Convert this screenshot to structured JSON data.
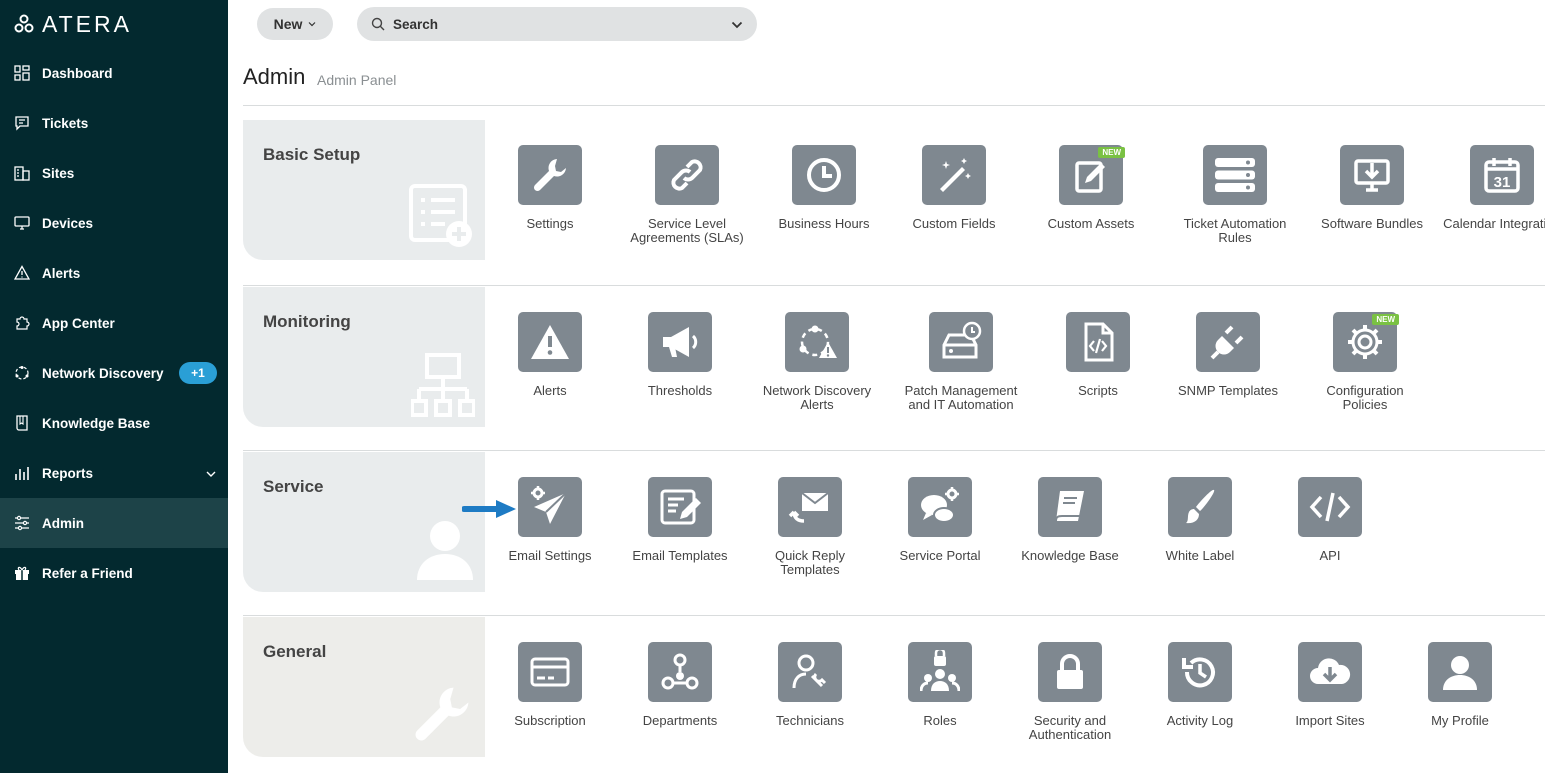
{
  "app": {
    "logo_text": "ATERA"
  },
  "sidebar": {
    "items": [
      {
        "label": "Dashboard",
        "icon": "dashboard-icon"
      },
      {
        "label": "Tickets",
        "icon": "tickets-icon"
      },
      {
        "label": "Sites",
        "icon": "sites-icon"
      },
      {
        "label": "Devices",
        "icon": "devices-icon"
      },
      {
        "label": "Alerts",
        "icon": "alerts-icon"
      },
      {
        "label": "App Center",
        "icon": "app-center-icon"
      },
      {
        "label": "Network Discovery",
        "icon": "network-discovery-icon",
        "badge": "+1"
      },
      {
        "label": "Knowledge Base",
        "icon": "knowledge-base-icon"
      },
      {
        "label": "Reports",
        "icon": "reports-icon"
      },
      {
        "label": "Admin",
        "icon": "admin-icon",
        "active": true
      },
      {
        "label": "Refer a Friend",
        "icon": "gift-icon"
      }
    ]
  },
  "toolbar": {
    "new_label": "New",
    "search_label": "Search"
  },
  "page": {
    "title": "Admin",
    "subtitle": "Admin Panel"
  },
  "sections": [
    {
      "title": "Basic Setup",
      "tiles": [
        {
          "label": "Settings",
          "icon": "wrench-icon"
        },
        {
          "label": "Service Level Agreements (SLAs)",
          "icon": "link-icon"
        },
        {
          "label": "Business Hours",
          "icon": "clock-icon"
        },
        {
          "label": "Custom Fields",
          "icon": "magic-wand-icon"
        },
        {
          "label": "Custom Assets",
          "icon": "edit-clipboard-icon",
          "new": "NEW"
        },
        {
          "label": "Ticket Automation Rules",
          "icon": "server-stack-icon"
        },
        {
          "label": "Software Bundles",
          "icon": "download-monitor-icon"
        },
        {
          "label": "Calendar Integration",
          "icon": "calendar-icon",
          "day": "31"
        }
      ]
    },
    {
      "title": "Monitoring",
      "tiles": [
        {
          "label": "Alerts",
          "icon": "warning-icon"
        },
        {
          "label": "Thresholds",
          "icon": "megaphone-icon"
        },
        {
          "label": "Network Discovery Alerts",
          "icon": "network-alert-icon"
        },
        {
          "label": "Patch Management and IT Automation",
          "icon": "patch-drive-icon"
        },
        {
          "label": "Scripts",
          "icon": "script-file-icon"
        },
        {
          "label": "SNMP Templates",
          "icon": "plug-icon"
        },
        {
          "label": "Configuration Policies",
          "icon": "gear-icon",
          "new": "NEW"
        }
      ]
    },
    {
      "title": "Service",
      "tiles": [
        {
          "label": "Email Settings",
          "icon": "paper-plane-gear-icon"
        },
        {
          "label": "Email Templates",
          "icon": "edit-template-icon"
        },
        {
          "label": "Quick Reply Templates",
          "icon": "reply-mail-icon"
        },
        {
          "label": "Service Portal",
          "icon": "chat-gear-icon"
        },
        {
          "label": "Knowledge Base",
          "icon": "book-icon"
        },
        {
          "label": "White Label",
          "icon": "brush-icon"
        },
        {
          "label": "API",
          "icon": "code-icon"
        }
      ]
    },
    {
      "title": "General",
      "tiles": [
        {
          "label": "Subscription",
          "icon": "credit-card-icon"
        },
        {
          "label": "Departments",
          "icon": "departments-icon"
        },
        {
          "label": "Technicians",
          "icon": "technician-icon"
        },
        {
          "label": "Roles",
          "icon": "roles-icon"
        },
        {
          "label": "Security and Authentication",
          "icon": "lock-icon"
        },
        {
          "label": "Activity Log",
          "icon": "history-icon"
        },
        {
          "label": "Import Sites",
          "icon": "cloud-download-icon"
        },
        {
          "label": "My Profile",
          "icon": "user-icon"
        }
      ]
    }
  ]
}
